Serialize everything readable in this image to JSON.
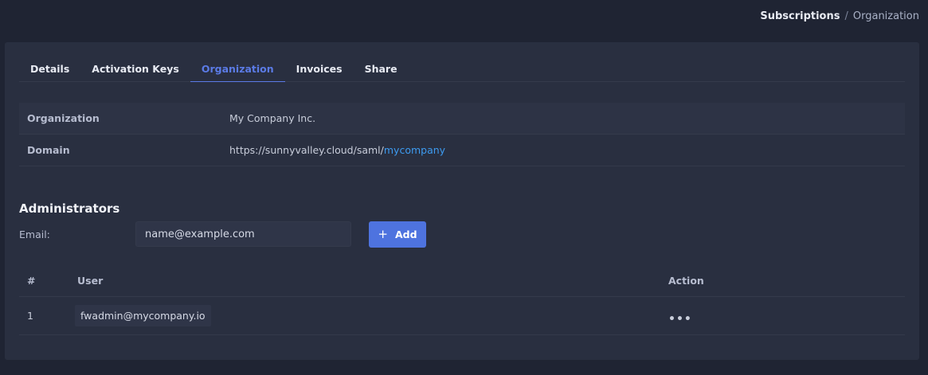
{
  "breadcrumb": {
    "parent": "Subscriptions",
    "separator": "/",
    "current": "Organization"
  },
  "tabs": [
    {
      "label": "Details"
    },
    {
      "label": "Activation Keys"
    },
    {
      "label": "Organization"
    },
    {
      "label": "Invoices"
    },
    {
      "label": "Share"
    }
  ],
  "organization": {
    "org_label": "Organization",
    "org_value": "My Company Inc.",
    "domain_label": "Domain",
    "domain_prefix": "https://sunnyvalley.cloud/saml/",
    "domain_slug": "mycompany"
  },
  "administrators": {
    "title": "Administrators",
    "email_label": "Email:",
    "email_placeholder": "name@example.com",
    "add_label": "Add",
    "table": {
      "headers": {
        "num": "#",
        "user": "User",
        "action": "Action"
      },
      "rows": [
        {
          "num": "1",
          "user": "fwadmin@mycompany.io"
        }
      ]
    }
  },
  "colors": {
    "accent": "#4e73df",
    "link": "#3d9bf0",
    "card": "#292f40",
    "background": "#1f2433"
  },
  "icons": {
    "add": "plus-icon",
    "row_action": "more-horizontal-icon"
  }
}
